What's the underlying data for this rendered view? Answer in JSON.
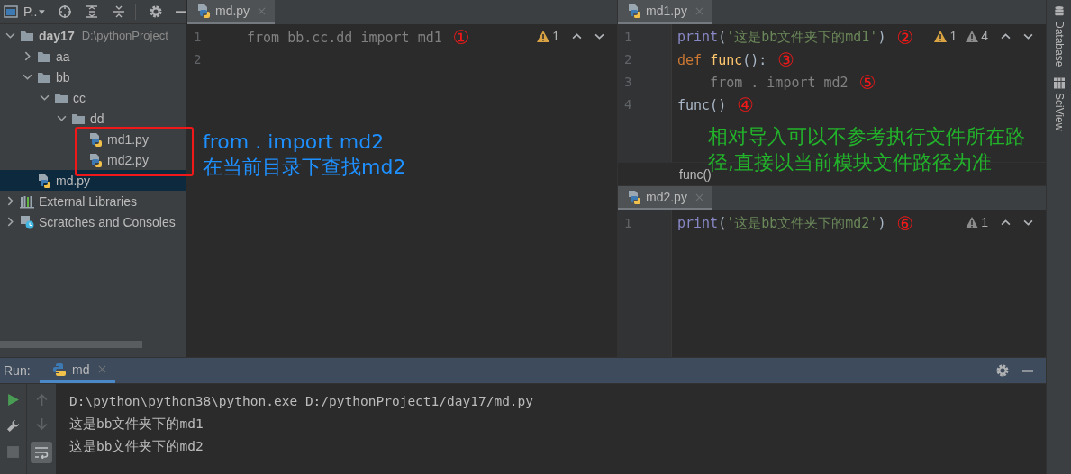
{
  "project_panel": {
    "title": "P..",
    "tree": [
      {
        "name": "day17",
        "path": "D:\\pythonProject",
        "kind": "folder",
        "expanded": true,
        "selected": false,
        "children": [
          {
            "name": "aa",
            "kind": "folder",
            "expanded": false,
            "selected": false
          },
          {
            "name": "bb",
            "kind": "folder",
            "expanded": true,
            "selected": false,
            "children": [
              {
                "name": "cc",
                "kind": "folder",
                "expanded": true,
                "selected": false,
                "children": [
                  {
                    "name": "dd",
                    "kind": "folder",
                    "expanded": true,
                    "selected": false,
                    "children": [
                      {
                        "name": "md1.py",
                        "kind": "python-file",
                        "selected": false
                      },
                      {
                        "name": "md2.py",
                        "kind": "python-file",
                        "selected": false
                      }
                    ]
                  }
                ]
              }
            ]
          },
          {
            "name": "md.py",
            "kind": "python-file",
            "selected": true
          }
        ]
      },
      {
        "name": "External Libraries",
        "kind": "library",
        "expanded": false,
        "selected": false
      },
      {
        "name": "Scratches and Consoles",
        "kind": "scratches",
        "expanded": false,
        "selected": false
      }
    ]
  },
  "editors": [
    {
      "tab": {
        "label": "md.py",
        "selected": true
      },
      "inspections": [
        {
          "count": "1",
          "kind": "warning"
        }
      ],
      "lines": [
        {
          "number": "1",
          "segments": [
            {
              "text": "from bb.cc.dd import md1",
              "kind": "unused"
            }
          ],
          "annotation": "①"
        },
        {
          "number": "2"
        }
      ]
    },
    {
      "tab": {
        "label": "md1.py",
        "selected": true
      },
      "inspections": [
        {
          "count": "1",
          "kind": "warning"
        },
        {
          "count": "4",
          "kind": "weak"
        }
      ],
      "lines": [
        {
          "number": "1",
          "segments": [
            {
              "text": "print",
              "kind": "builtin"
            },
            {
              "text": "(",
              "kind": "plain"
            },
            {
              "text": "'这是bb文件夹下的md1'",
              "kind": "string"
            },
            {
              "text": ")",
              "kind": "plain"
            }
          ],
          "annotation": "②"
        },
        {
          "number": "2",
          "segments": [
            {
              "text": "def ",
              "kind": "keyword"
            },
            {
              "text": "func",
              "kind": "function"
            },
            {
              "text": "():",
              "kind": "plain"
            }
          ],
          "annotation": "③"
        },
        {
          "number": "3",
          "segments": [
            {
              "text": "    from . import md2",
              "kind": "unused"
            }
          ],
          "annotation": "⑤"
        },
        {
          "number": "4",
          "segments": [
            {
              "text": "func()",
              "kind": "plain"
            }
          ],
          "annotation": "④"
        }
      ],
      "breadcrumb": "func()"
    },
    {
      "tab": {
        "label": "md2.py",
        "selected": true
      },
      "inspections": [
        {
          "count": "1",
          "kind": "weak"
        }
      ],
      "lines": [
        {
          "number": "1",
          "segments": [
            {
              "text": "print",
              "kind": "builtin"
            },
            {
              "text": "(",
              "kind": "plain"
            },
            {
              "text": "'这是bb文件夹下的md2'",
              "kind": "string"
            },
            {
              "text": ")",
              "kind": "plain"
            }
          ],
          "annotation": "⑥"
        }
      ]
    }
  ],
  "notes": [
    {
      "kind": "blue",
      "lines": [
        "from . import md2",
        "在当前目录下查找md2"
      ]
    },
    {
      "kind": "green",
      "lines": [
        "相对导入可以不参考执行文件所在路径,直接以当前模块文件路径为准"
      ]
    }
  ],
  "tool_strip": [
    {
      "label": "Database",
      "kind": "database"
    },
    {
      "label": "SciView",
      "kind": "grid"
    }
  ],
  "run_panel": {
    "label": "Run:",
    "tabs": [
      {
        "label": "md",
        "selected": true
      }
    ],
    "output": [
      "D:\\python\\python38\\python.exe D:/pythonProject1/day17/md.py",
      "这是bb文件夹下的md1",
      "这是bb文件夹下的md2"
    ],
    "soft_wrap_on": true
  }
}
